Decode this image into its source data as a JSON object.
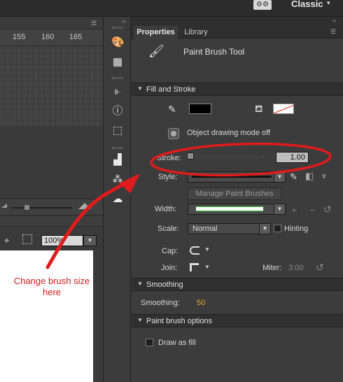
{
  "topbar": {
    "workspace_label": "Classic",
    "workspace_icon": "workspace-switcher-icon"
  },
  "timeline": {
    "frame_numbers": [
      "155",
      "160",
      "165"
    ]
  },
  "stage": {
    "zoom_value": "100%"
  },
  "properties_panel": {
    "tabs": [
      {
        "label": "Properties",
        "active": true
      },
      {
        "label": "Library",
        "active": false
      }
    ],
    "tool_name": "Paint Brush Tool",
    "sections": {
      "fill_and_stroke": "Fill and Stroke",
      "smoothing": "Smoothing",
      "paint_brush_options": "Paint brush options"
    },
    "stroke_color": "#000000",
    "fill_color": "none",
    "object_drawing_label": "Object drawing mode off",
    "stroke_label": "Stroke:",
    "stroke_value": "1.00",
    "style_label": "Style:",
    "manage_brushes_label": "Manage Paint Brushes",
    "width_label": "Width:",
    "scale_label": "Scale:",
    "scale_value": "Normal",
    "hinting_label": "Hinting",
    "cap_label": "Cap:",
    "join_label": "Join:",
    "miter_label": "Miter:",
    "miter_value": "3.00",
    "smoothing_label": "Smoothing:",
    "smoothing_value": "50",
    "draw_as_fill_label": "Draw as fill"
  },
  "annotation": {
    "callout_text": "Change brush size here",
    "color": "#e01b1b"
  }
}
